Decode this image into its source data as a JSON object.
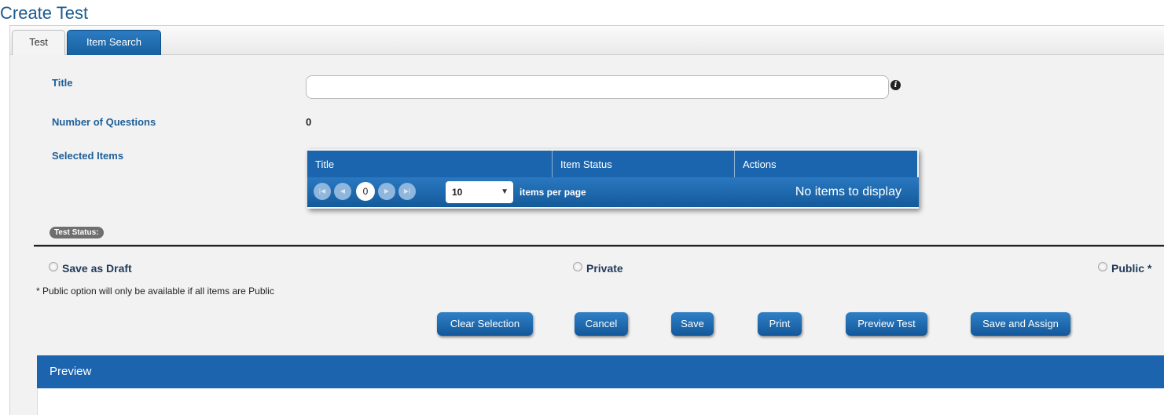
{
  "page": {
    "title": "Create Test"
  },
  "tabs": [
    {
      "label": "Test",
      "active": false
    },
    {
      "label": "Item Search",
      "active": true
    }
  ],
  "form": {
    "title_label": "Title",
    "title_value": "",
    "questions_label": "Number of Questions",
    "questions_value": "0",
    "selected_label": "Selected Items"
  },
  "grid": {
    "columns": [
      "Title",
      "Item Status",
      "Actions"
    ],
    "current_page": "0",
    "page_size": "10",
    "per_page_label": "items per page",
    "empty_message": "No items to display"
  },
  "status": {
    "badge": "Test Status:",
    "options": [
      {
        "label": "Save as Draft",
        "selected": false
      },
      {
        "label": "Private",
        "selected": false
      },
      {
        "label": "Public *",
        "selected": false
      }
    ],
    "note": "* Public option will only be available if all items are Public"
  },
  "buttons": {
    "clear": "Clear Selection",
    "cancel": "Cancel",
    "save": "Save",
    "print": "Print",
    "preview": "Preview Test",
    "save_assign": "Save and Assign"
  },
  "preview": {
    "title": "Preview"
  },
  "colors": {
    "accent": "#1a65ae",
    "panel": "#f2f2f2",
    "heading": "#1e5a8e"
  }
}
